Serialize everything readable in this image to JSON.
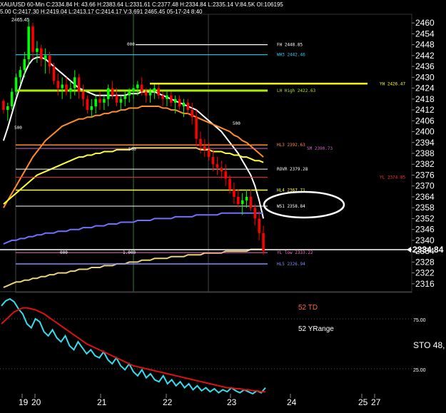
{
  "header": {
    "text": "XAU/USD 60-Min C:2334.84 H: 43.66 H:2383.64 L:2331.61 C:2377.48 H:2334.84 L:2335.14 V:84.5K OI:106195",
    "sub_text": "5.00 C:2417.30 H:2419.04 L:2413.17 C:2414.17 V:3,691 2465.45 05-17-24 8:40",
    "top_value": "2465.45"
  },
  "colors": {
    "background": "#000000",
    "candle_up": "#00ff00",
    "candle_down": "#ff0000",
    "ma_white": "#ffffff",
    "ma_orange": "#ff8c2a",
    "ma_yellow": "#ffff33",
    "ma_blue": "#7070ff",
    "sto_cyan": "#33ddee",
    "sto_red": "#dd1111"
  },
  "chart_data": [
    {
      "type": "candlestick",
      "ylim": [
        2312,
        2464
      ],
      "y_ticks": [
        2460,
        2454,
        2448,
        2442,
        2436,
        2430,
        2424,
        2418,
        2412,
        2406,
        2400,
        2394,
        2388,
        2382,
        2376,
        2370,
        2364,
        2358,
        2352,
        2346,
        2340,
        2334,
        2328,
        2322,
        2316
      ],
      "x_ticks": [
        "19",
        "20",
        "21",
        "22",
        "23",
        "24",
        "25",
        "27"
      ],
      "last_price": "2334.84",
      "candles": [
        [
          2417,
          2418,
          2410,
          2412
        ],
        [
          2412,
          2416,
          2406,
          2414
        ],
        [
          2414,
          2424,
          2412,
          2422
        ],
        [
          2422,
          2432,
          2420,
          2430
        ],
        [
          2430,
          2436,
          2426,
          2434
        ],
        [
          2434,
          2444,
          2430,
          2440
        ],
        [
          2440,
          2462,
          2436,
          2458
        ],
        [
          2458,
          2460,
          2440,
          2444
        ],
        [
          2444,
          2450,
          2438,
          2446
        ],
        [
          2446,
          2448,
          2436,
          2440
        ],
        [
          2440,
          2446,
          2432,
          2442
        ],
        [
          2442,
          2444,
          2432,
          2436
        ],
        [
          2436,
          2438,
          2426,
          2428
        ],
        [
          2428,
          2432,
          2420,
          2424
        ],
        [
          2424,
          2430,
          2418,
          2426
        ],
        [
          2426,
          2430,
          2420,
          2422
        ],
        [
          2422,
          2428,
          2418,
          2424
        ],
        [
          2424,
          2434,
          2420,
          2430
        ],
        [
          2430,
          2432,
          2418,
          2422
        ],
        [
          2422,
          2426,
          2414,
          2418
        ],
        [
          2418,
          2420,
          2410,
          2412
        ],
        [
          2412,
          2418,
          2408,
          2414
        ],
        [
          2414,
          2420,
          2410,
          2418
        ],
        [
          2418,
          2422,
          2412,
          2416
        ],
        [
          2416,
          2420,
          2412,
          2418
        ],
        [
          2418,
          2426,
          2414,
          2424
        ],
        [
          2424,
          2428,
          2418,
          2420
        ],
        [
          2420,
          2424,
          2414,
          2416
        ],
        [
          2416,
          2420,
          2412,
          2418
        ],
        [
          2418,
          2422,
          2414,
          2420
        ],
        [
          2420,
          2424,
          2416,
          2422
        ],
        [
          2422,
          2426,
          2418,
          2424
        ],
        [
          2424,
          2428,
          2420,
          2426
        ],
        [
          2426,
          2430,
          2420,
          2422
        ],
        [
          2422,
          2424,
          2416,
          2420
        ],
        [
          2420,
          2424,
          2416,
          2422
        ],
        [
          2422,
          2426,
          2418,
          2424
        ],
        [
          2424,
          2426,
          2418,
          2420
        ],
        [
          2420,
          2422,
          2414,
          2418
        ],
        [
          2418,
          2422,
          2414,
          2420
        ],
        [
          2420,
          2422,
          2414,
          2416
        ],
        [
          2416,
          2420,
          2410,
          2418
        ],
        [
          2418,
          2420,
          2412,
          2414
        ],
        [
          2414,
          2418,
          2408,
          2416
        ],
        [
          2416,
          2418,
          2410,
          2412
        ],
        [
          2412,
          2416,
          2404,
          2408
        ],
        [
          2408,
          2412,
          2392,
          2396
        ],
        [
          2396,
          2400,
          2388,
          2392
        ],
        [
          2392,
          2396,
          2386,
          2390
        ],
        [
          2390,
          2394,
          2384,
          2386
        ],
        [
          2386,
          2390,
          2378,
          2382
        ],
        [
          2382,
          2386,
          2376,
          2380
        ],
        [
          2380,
          2384,
          2374,
          2378
        ],
        [
          2378,
          2382,
          2370,
          2374
        ],
        [
          2374,
          2376,
          2366,
          2368
        ],
        [
          2368,
          2372,
          2360,
          2364
        ],
        [
          2364,
          2368,
          2358,
          2360
        ],
        [
          2360,
          2366,
          2354,
          2362
        ],
        [
          2362,
          2368,
          2358,
          2364
        ],
        [
          2364,
          2368,
          2356,
          2358
        ],
        [
          2358,
          2360,
          2348,
          2352
        ],
        [
          2352,
          2356,
          2340,
          2344
        ],
        [
          2344,
          2348,
          2332,
          2334
        ]
      ],
      "moving_averages": [
        {
          "color": "#ffffff",
          "values": [
            2395,
            2402,
            2410,
            2418,
            2425,
            2432,
            2437,
            2440,
            2441,
            2441,
            2440,
            2438,
            2436,
            2434,
            2432,
            2430,
            2428,
            2426,
            2424,
            2423,
            2422,
            2421,
            2420,
            2420,
            2420,
            2420,
            2420,
            2420,
            2420,
            2420,
            2421,
            2421,
            2421,
            2422,
            2422,
            2422,
            2422,
            2421,
            2420,
            2419,
            2418,
            2417,
            2416,
            2415,
            2414,
            2413,
            2412,
            2410,
            2408,
            2406,
            2404,
            2402,
            2400,
            2397,
            2394,
            2391,
            2388,
            2384,
            2380,
            2376,
            2370,
            2362,
            2352
          ]
        },
        {
          "color": "#ff8c2a",
          "values": [
            2358,
            2362,
            2366,
            2370,
            2374,
            2378,
            2382,
            2386,
            2389,
            2392,
            2395,
            2397,
            2399,
            2401,
            2403,
            2404,
            2405,
            2406,
            2407,
            2407,
            2408,
            2408,
            2409,
            2409,
            2410,
            2410,
            2411,
            2411,
            2412,
            2412,
            2413,
            2413,
            2413,
            2414,
            2414,
            2414,
            2414,
            2414,
            2413,
            2413,
            2412,
            2412,
            2411,
            2410,
            2410,
            2409,
            2408,
            2407,
            2406,
            2405,
            2404,
            2403,
            2402,
            2401,
            2400,
            2398,
            2397,
            2395,
            2394,
            2392,
            2390,
            2388,
            2386
          ]
        },
        {
          "color": "#ffff33",
          "values": [
            2360,
            2362,
            2364,
            2366,
            2368,
            2370,
            2372,
            2374,
            2376,
            2377,
            2378,
            2379,
            2380,
            2381,
            2382,
            2383,
            2384,
            2385,
            2386,
            2386,
            2387,
            2387,
            2388,
            2388,
            2389,
            2389,
            2389,
            2390,
            2390,
            2390,
            2390,
            2391,
            2391,
            2391,
            2391,
            2391,
            2391,
            2391,
            2391,
            2391,
            2391,
            2391,
            2391,
            2391,
            2391,
            2391,
            2391,
            2390,
            2390,
            2390,
            2389,
            2389,
            2389,
            2388,
            2388,
            2387,
            2387,
            2386,
            2386,
            2385,
            2384,
            2384,
            2383
          ]
        },
        {
          "color": "#7070ff",
          "values": [
            2338,
            2339,
            2340,
            2340,
            2341,
            2341,
            2342,
            2342,
            2343,
            2343,
            2344,
            2344,
            2344,
            2345,
            2345,
            2345,
            2346,
            2346,
            2346,
            2347,
            2347,
            2347,
            2348,
            2348,
            2348,
            2349,
            2349,
            2349,
            2350,
            2350,
            2350,
            2350,
            2351,
            2351,
            2351,
            2351,
            2352,
            2352,
            2352,
            2352,
            2352,
            2353,
            2353,
            2353,
            2353,
            2353,
            2354,
            2354,
            2354,
            2354,
            2354,
            2354,
            2355,
            2355,
            2355,
            2355,
            2355,
            2355,
            2355,
            2355,
            2355,
            2355,
            2355
          ]
        },
        {
          "color": "#e8d27a",
          "values": [
            2314,
            2315,
            2316,
            2317,
            2317,
            2318,
            2318,
            2319,
            2319,
            2320,
            2320,
            2321,
            2321,
            2322,
            2322,
            2322,
            2323,
            2323,
            2324,
            2324,
            2324,
            2325,
            2325,
            2325,
            2326,
            2326,
            2326,
            2327,
            2327,
            2327,
            2328,
            2328,
            2328,
            2329,
            2329,
            2329,
            2330,
            2330,
            2330,
            2330,
            2331,
            2331,
            2331,
            2331,
            2332,
            2332,
            2332,
            2332,
            2333,
            2333,
            2333,
            2333,
            2333,
            2334,
            2334,
            2334,
            2334,
            2334,
            2334,
            2335,
            2335,
            2335,
            2335
          ]
        }
      ],
      "levels": [
        {
          "price": 2448,
          "color": "#ffffff",
          "label": "FH 2448.85",
          "lw": 1.2
        },
        {
          "price": 2442.46,
          "color": "#33ccee",
          "label": "WH3 2442.46",
          "lw": 1.2
        },
        {
          "price": 2426.47,
          "color": "#ffff00",
          "label": "YH 2426.47",
          "lw": 2.5
        },
        {
          "price": 2422.63,
          "color": "#aaee00",
          "label": "LH High 2422.63",
          "lw": 3
        },
        {
          "price": 2392.63,
          "color": "#ff8c2a",
          "label": "HL3 2392.63",
          "lw": 1.5
        },
        {
          "price": 2390.73,
          "color": "#cc66cc",
          "label": "SM 2390.73",
          "lw": 1
        },
        {
          "price": 2379.28,
          "color": "#ffffff",
          "label": "ROVR 2379.28",
          "lw": 1
        },
        {
          "price": 2374.85,
          "color": "#ff3333",
          "label": "YL 2374.85",
          "lw": 1
        },
        {
          "price": 2367.71,
          "color": "#ffff33",
          "label": "HL4 2367.71",
          "lw": 1.5
        },
        {
          "price": 2358.84,
          "color": "#ffffff",
          "label": "WS1 2358.84",
          "lw": 1
        },
        {
          "price": 2333.22,
          "color": "#ff66cc",
          "label": "YL low 2333.22",
          "lw": 1
        },
        {
          "price": 2326.94,
          "color": "#8888ff",
          "label": "HL5 2326.94",
          "lw": 1.5
        }
      ],
      "annotations": [
        "000",
        "500",
        "500",
        "500",
        "000",
        "1.000"
      ],
      "highlight": "WS1 2358.84"
    },
    {
      "type": "line",
      "indicator": "STO",
      "ylim": [
        0,
        100
      ],
      "y_ticks": [
        "75.00",
        "25.00"
      ],
      "right_label": "STO 48,",
      "labels": [
        "52 TD",
        "52 YRange"
      ],
      "series": [
        {
          "color": "#33ddee",
          "values": [
            88,
            93,
            95,
            92,
            85,
            80,
            70,
            66,
            75,
            72,
            62,
            58,
            64,
            56,
            52,
            58,
            48,
            44,
            52,
            46,
            40,
            44,
            38,
            36,
            42,
            34,
            30,
            36,
            28,
            24,
            30,
            22,
            18,
            24,
            16,
            20,
            14,
            12,
            18,
            10,
            14,
            8,
            12,
            6,
            10,
            4,
            8,
            3,
            6,
            2,
            5,
            1,
            4,
            2,
            6,
            3,
            1,
            4,
            2,
            0,
            3,
            1,
            6
          ]
        },
        {
          "color": "#dd1111",
          "values": [
            70,
            74,
            78,
            82,
            84,
            86,
            86,
            85,
            84,
            82,
            80,
            77,
            74,
            71,
            68,
            65,
            62,
            59,
            56,
            53,
            50,
            48,
            46,
            44,
            42,
            40,
            38,
            36,
            34,
            32,
            30,
            28,
            27,
            26,
            25,
            24,
            23,
            22,
            21,
            20,
            19,
            18,
            17,
            16,
            15,
            14,
            13,
            12,
            11,
            10,
            9,
            8,
            7,
            6,
            6,
            5,
            5,
            4,
            4,
            3,
            3,
            2,
            2
          ]
        }
      ]
    }
  ]
}
